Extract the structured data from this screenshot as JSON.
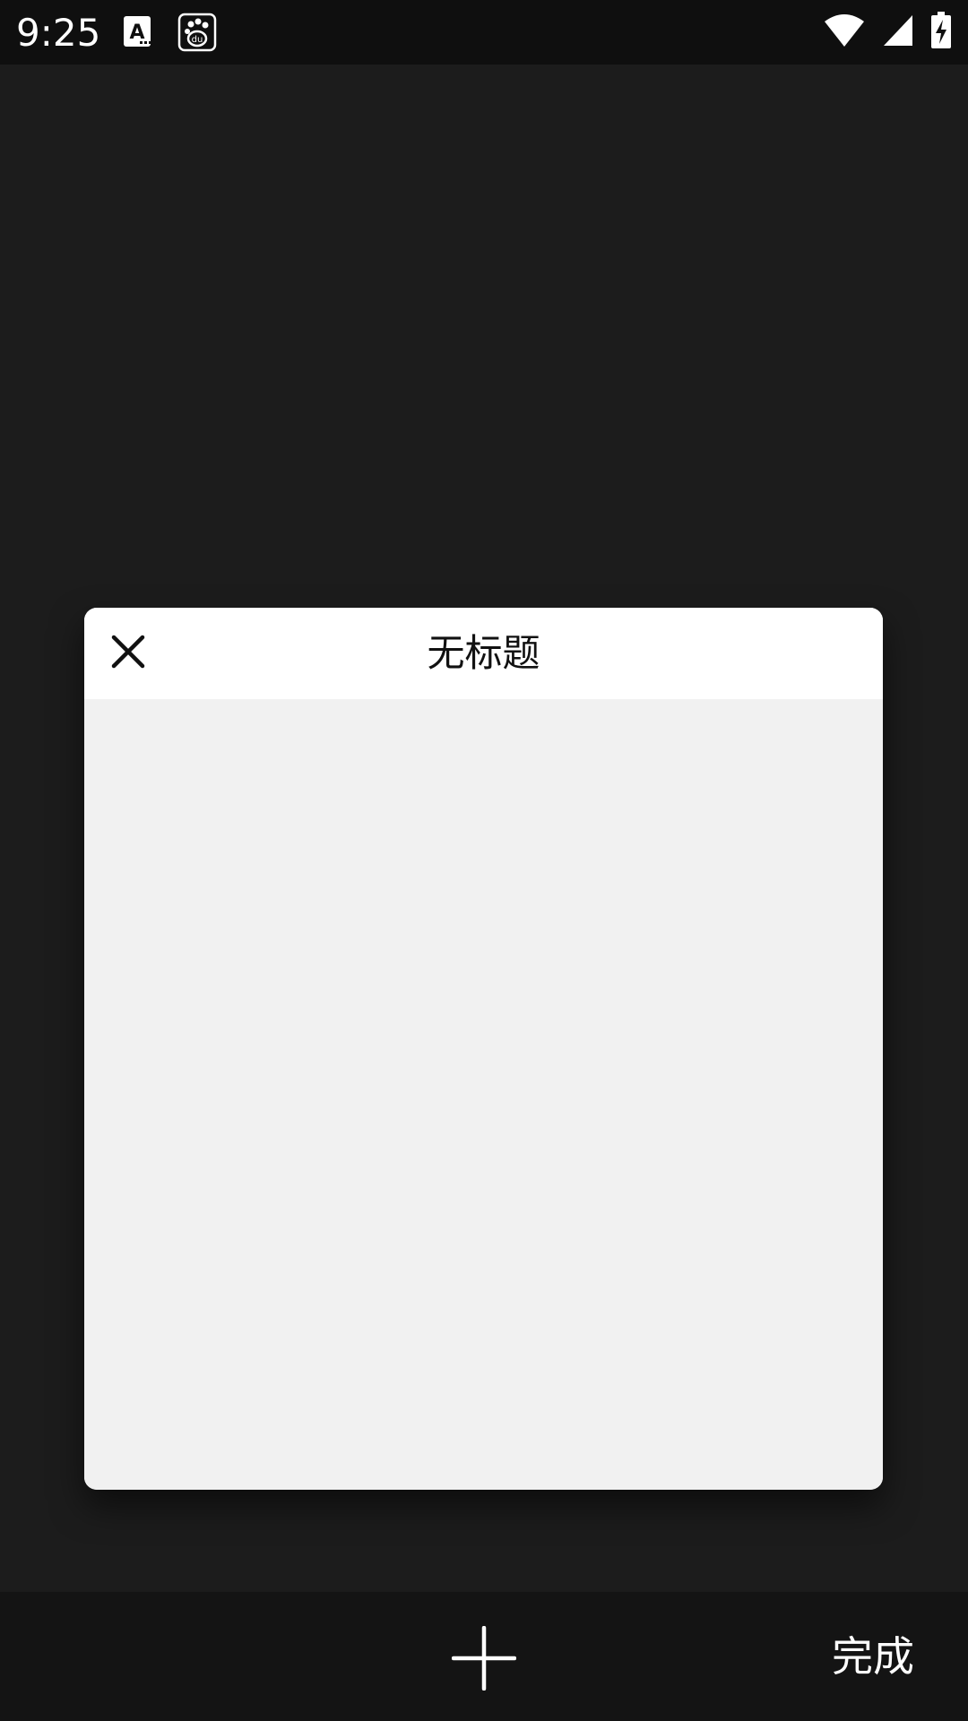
{
  "status_bar": {
    "time": "9:25",
    "notification_icons": [
      "app-a-icon",
      "baidu-paw-icon"
    ],
    "system_icons": [
      "wifi-icon",
      "cell-signal-icon",
      "battery-charging-icon"
    ]
  },
  "tab_card": {
    "title": "无标题",
    "close_icon": "close-icon"
  },
  "bottom_bar": {
    "add_icon": "plus-icon",
    "done_label": "完成"
  },
  "colors": {
    "background": "#1c1c1c",
    "status_bar": "#0f0f0f",
    "bottom_bar": "#141414",
    "card_header": "#ffffff",
    "card_body": "#f1f1f1",
    "text_light": "#ffffff",
    "text_dark": "#111111"
  }
}
